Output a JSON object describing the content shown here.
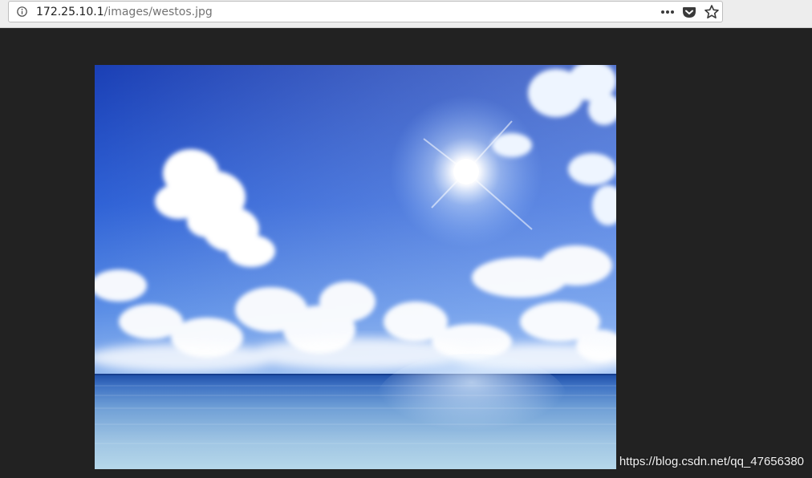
{
  "address_bar": {
    "host": "172.25.10.1",
    "path": "/images/westos.jpg"
  },
  "icons": {
    "site_info": "info-icon",
    "page_actions": "more-horizontal-icon",
    "pocket": "pocket-icon",
    "bookmark": "star-icon"
  },
  "image": {
    "subject": "sky-and-sea-photo"
  },
  "watermark": {
    "text": "https://blog.csdn.net/qq_47656380"
  },
  "colors": {
    "page_background": "#222222",
    "toolbar_background": "#ededed"
  }
}
